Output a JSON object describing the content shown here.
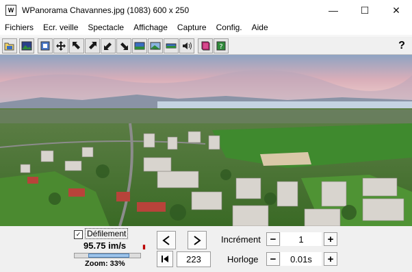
{
  "window": {
    "title": "WPanorama  Chavannes.jpg  (1083) 600 x 250",
    "app_icon_label": "W",
    "minimize": "—",
    "maximize": "☐",
    "close": "✕"
  },
  "menu": [
    {
      "label": "Fichiers"
    },
    {
      "label": "Ecr. veille"
    },
    {
      "label": "Spectacle"
    },
    {
      "label": "Affichage"
    },
    {
      "label": "Capture"
    },
    {
      "label": "Config."
    },
    {
      "label": "Aide"
    }
  ],
  "toolbar": {
    "buttons": [
      "open-icon",
      "picture-icon",
      "fit-icon",
      "move-icon",
      "arrow-nw-icon",
      "arrow-ne-icon",
      "arrow-sw-icon",
      "arrow-se-icon",
      "panorama-view-icon",
      "panorama-zoom-icon",
      "panorama-strip-icon",
      "sound-icon",
      "book-icon",
      "help-book-icon"
    ],
    "help_label": "?"
  },
  "controls": {
    "scroll_checkbox_mark": "✓",
    "scroll_label": "Défilement",
    "speed": "95.75 im/s",
    "zoom": "Zoom: 33%",
    "zoom_level": 0.33,
    "prev_glyph": "◀",
    "next_glyph": "▶",
    "first_glyph": "|◀",
    "frame": "223",
    "increment_label": "Incrément",
    "increment_value": "1",
    "clock_label": "Horloge",
    "clock_value": "0.01s",
    "minus": "−",
    "plus": "+"
  },
  "colors": {
    "accent": "#4a7fb8",
    "sky_top": "#9fb0c8",
    "sky_pink": "#e7b7bf",
    "lake": "#c5d3e2",
    "field_green": "#3f8a2e",
    "building": "#d8d4ce"
  }
}
